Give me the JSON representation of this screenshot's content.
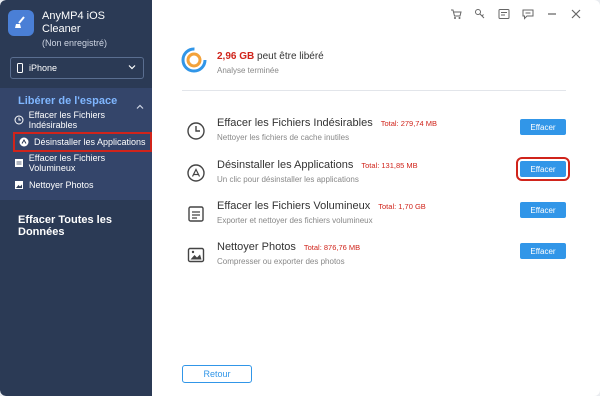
{
  "app": {
    "name": "AnyMP4 iOS Cleaner",
    "registration": "(Non enregistré)"
  },
  "device": {
    "selected": "iPhone"
  },
  "sidebar": {
    "section_title": "Libérer de l'espace",
    "items": [
      {
        "label": "Effacer les Fichiers Indésirables",
        "icon": "clock-icon"
      },
      {
        "label": "Désinstaller les Applications",
        "icon": "app-icon",
        "selected": true
      },
      {
        "label": "Effacer les Fichiers Volumineux",
        "icon": "file-icon"
      },
      {
        "label": "Nettoyer Photos",
        "icon": "photo-icon"
      }
    ],
    "erase_all": "Effacer Toutes les Données"
  },
  "summary": {
    "amount": "2,96 GB",
    "text": "peut être libéré",
    "status": "Analyse terminée"
  },
  "rows": [
    {
      "title": "Effacer les Fichiers Indésirables",
      "total": "Total: 279,74 MB",
      "desc": "Nettoyer les fichiers de cache inutiles",
      "button": "Effacer"
    },
    {
      "title": "Désinstaller les Applications",
      "total": "Total: 131,85 MB",
      "desc": "Un clic pour désinstaller les applications",
      "button": "Effacer"
    },
    {
      "title": "Effacer les Fichiers Volumineux",
      "total": "Total: 1,70 GB",
      "desc": "Exporter et nettoyer des fichiers volumineux",
      "button": "Effacer"
    },
    {
      "title": "Nettoyer Photos",
      "total": "Total: 876,76 MB",
      "desc": "Compresser ou exporter des photos",
      "button": "Effacer"
    }
  ],
  "footer": {
    "back": "Retour"
  },
  "colors": {
    "sidebar": "#2b3a55",
    "accent": "#3196e8",
    "highlight": "#d0241b",
    "section_title": "#7fb6ff"
  },
  "top_icons": [
    "cart-icon",
    "key-icon",
    "feedback-icon",
    "chat-icon",
    "minimize-icon",
    "close-icon"
  ]
}
